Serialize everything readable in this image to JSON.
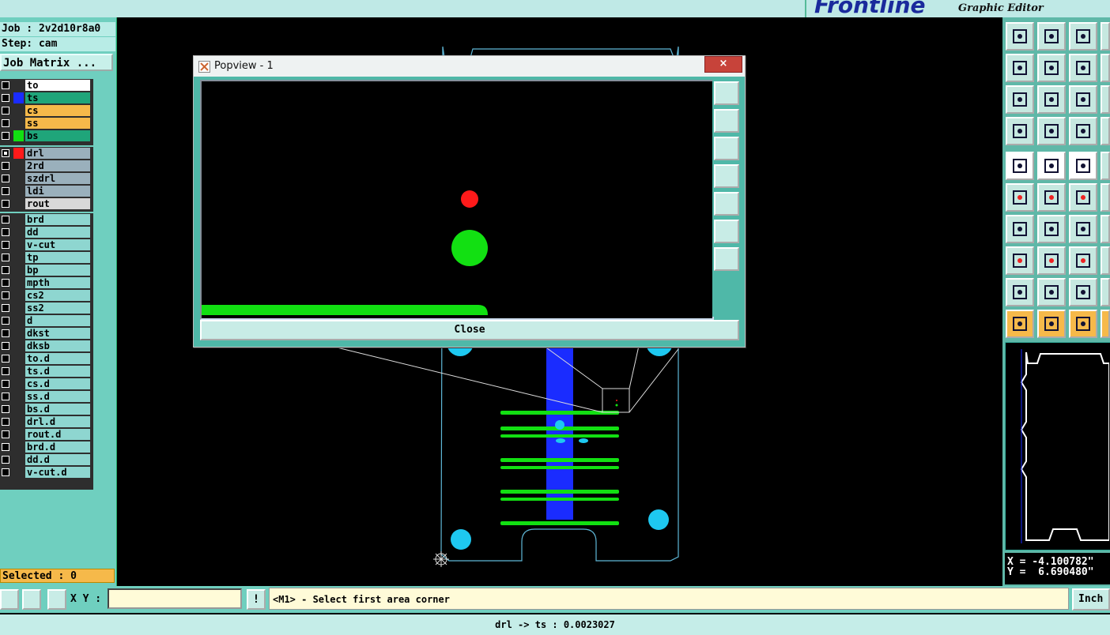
{
  "app": {
    "brand": "Frontline",
    "subtitle": "Graphic Editor"
  },
  "job_info": {
    "job": "Job : 2v2d10r8a0",
    "step": "Step: cam",
    "job_matrix_button": "Job Matrix ..."
  },
  "layers": {
    "group1": [
      {
        "name": "to",
        "color": "#ffffff",
        "swatch": "",
        "checked": false
      },
      {
        "name": "ts",
        "color": "#1fa57a",
        "swatch": "#1a2cff",
        "checked": false
      },
      {
        "name": "cs",
        "color": "#f6b94a",
        "swatch": "",
        "checked": false
      },
      {
        "name": "ss",
        "color": "#f6b94a",
        "swatch": "",
        "checked": false
      },
      {
        "name": "bs",
        "color": "#1fa57a",
        "swatch": "#12e012",
        "checked": false
      }
    ],
    "group2": [
      {
        "name": "drl",
        "color": "#9ab0bc",
        "swatch": "#ff1a1a",
        "checked": true
      },
      {
        "name": "2rd",
        "color": "#9ab0bc",
        "swatch": "",
        "checked": false
      },
      {
        "name": "szdrl",
        "color": "#9ab0bc",
        "swatch": "",
        "checked": false
      },
      {
        "name": "ldi",
        "color": "#9ab0bc",
        "swatch": "",
        "checked": false
      },
      {
        "name": "rout",
        "color": "#d8d8d8",
        "swatch": "",
        "checked": false
      }
    ],
    "group3": [
      {
        "name": "brd"
      },
      {
        "name": "dd"
      },
      {
        "name": "v-cut"
      },
      {
        "name": "tp"
      },
      {
        "name": "bp"
      },
      {
        "name": "mpth"
      },
      {
        "name": "cs2"
      },
      {
        "name": "ss2"
      },
      {
        "name": "d"
      },
      {
        "name": "dkst"
      },
      {
        "name": "dksb"
      },
      {
        "name": "to.d"
      },
      {
        "name": "ts.d"
      },
      {
        "name": "cs.d"
      },
      {
        "name": "ss.d"
      },
      {
        "name": "bs.d"
      },
      {
        "name": "drl.d"
      },
      {
        "name": "rout.d"
      },
      {
        "name": "brd.d"
      },
      {
        "name": "dd.d"
      },
      {
        "name": "v-cut.d"
      }
    ]
  },
  "selected": "Selected : 0",
  "popup": {
    "title": "Popview - 1",
    "close_x": "×",
    "close_button": "Close"
  },
  "coords": {
    "x": "X = -4.100782\"",
    "y": "Y =  6.690480\""
  },
  "command": {
    "xy_label": "X Y :",
    "xy_value": "",
    "prompt": "<M1> - Select first area corner",
    "unit": "Inch",
    "warn": "!"
  },
  "status": "drl -> ts : 0.0023027",
  "colors": {
    "panel": "#6fcfbf",
    "ts_green": "#12e012",
    "drill_red": "#ff1a1a",
    "pad_cyan": "#1ec8f0",
    "blue_bar": "#1a2cff",
    "outline": "#5fb8d8"
  },
  "tools": {
    "right": [
      "zoom-home-icon",
      "zoom-out-icon",
      "home-icon",
      "pan-left-icon",
      "pan-right-icon",
      "swap-icon",
      "fit-icon",
      "center-icon",
      "scale-icon",
      "measure-icon",
      "grid-icon",
      "snap-icon",
      "pad-icon",
      "select-area-icon",
      "ruler-icon",
      "connect-icon",
      "delete-icon",
      "move-icon",
      "line-icon",
      "line2-icon",
      "arc-icon",
      "pad-red-icon",
      "edit-line-icon",
      "box-icon",
      "triangle-icon",
      "triangle2-icon",
      "triangle3-icon",
      "cursor-icon",
      "cursor2-icon",
      "cursor3-icon"
    ]
  }
}
